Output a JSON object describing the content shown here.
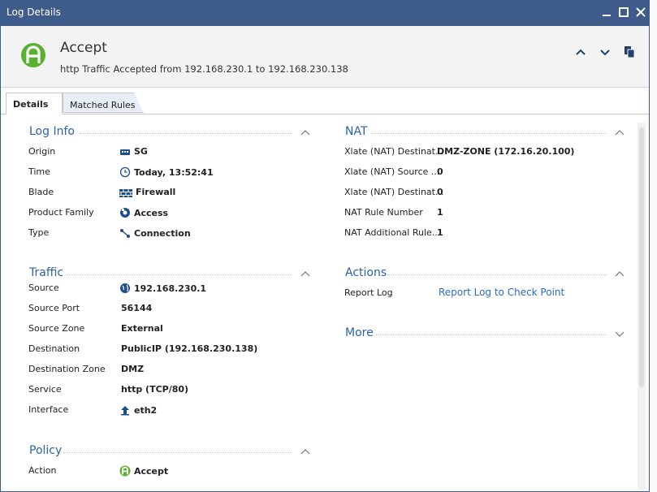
{
  "window": {
    "title": "Log Details"
  },
  "header": {
    "title": "Accept",
    "subtitle": "http Traffic Accepted from 192.168.230.1 to 192.168.230.138"
  },
  "tabs": [
    {
      "label": "Details"
    },
    {
      "label": "Matched Rules"
    }
  ],
  "log_info": {
    "title": "Log Info",
    "rows": [
      {
        "label": "Origin",
        "value": "SG",
        "icon": "gateway-icon"
      },
      {
        "label": "Time",
        "value": "Today, 13:52:41",
        "icon": "clock-icon"
      },
      {
        "label": "Blade",
        "value": "Firewall",
        "icon": "firewall-icon"
      },
      {
        "label": "Product Family",
        "value": "Access",
        "icon": "access-icon"
      },
      {
        "label": "Type",
        "value": "Connection",
        "icon": "connection-icon"
      }
    ]
  },
  "traffic": {
    "title": "Traffic",
    "rows": [
      {
        "label": "Source",
        "value": "192.168.230.1",
        "icon": "globe-icon"
      },
      {
        "label": "Source Port",
        "value": "56144"
      },
      {
        "label": "Source Zone",
        "value": "External"
      },
      {
        "label": "Destination",
        "value": "PublicIP (192.168.230.138)"
      },
      {
        "label": "Destination Zone",
        "value": "DMZ"
      },
      {
        "label": "Service",
        "value": "http (TCP/80)"
      },
      {
        "label": "Interface",
        "value": "eth2",
        "icon": "interface-up-arrow-icon"
      }
    ]
  },
  "policy": {
    "title": "Policy",
    "rows": [
      {
        "label": "Action",
        "value": "Accept",
        "icon": "accept-icon"
      }
    ]
  },
  "nat": {
    "title": "NAT",
    "rows": [
      {
        "label": "Xlate (NAT) Destinat...",
        "value": "DMZ-ZONE (172.16.20.100)"
      },
      {
        "label": "Xlate (NAT) Source ...",
        "value": "0"
      },
      {
        "label": "Xlate (NAT) Destinat...",
        "value": "0"
      },
      {
        "label": "NAT Rule Number",
        "value": "1"
      },
      {
        "label": "NAT Additional Rule..",
        "value": "1"
      }
    ]
  },
  "actions": {
    "title": "Actions",
    "rows": [
      {
        "label": "Report Log",
        "value": "Report Log to Check Point"
      }
    ]
  },
  "more": {
    "title": "More"
  },
  "colors": {
    "titlebar": "#3e5b8a",
    "section_title": "#2b62a8",
    "link": "#2b6cc4",
    "accept_green": "#5ab030"
  }
}
